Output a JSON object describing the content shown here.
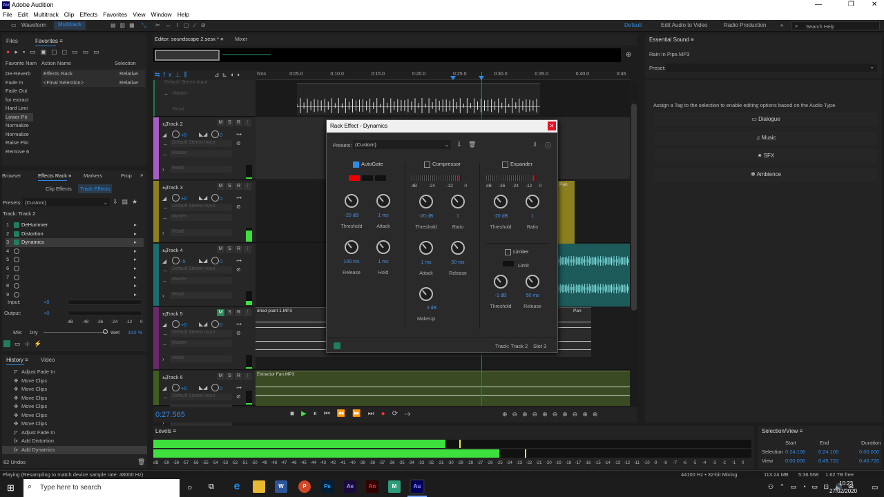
{
  "app": {
    "title": "Adobe Audition"
  },
  "menu": [
    "File",
    "Edit",
    "Multitrack",
    "Clip",
    "Effects",
    "Favorites",
    "View",
    "Window",
    "Help"
  ],
  "toolbar": {
    "waveform": "Waveform",
    "multitrack": "Multitrack",
    "workspaces": [
      "Default",
      "Edit Audio to Video",
      "Radio Production"
    ],
    "search_placeholder": "Search Help"
  },
  "files_panel": {
    "tabs": [
      "Files",
      "Favorites"
    ],
    "columns": [
      "Favorite Nam",
      "Action Name",
      "Selection"
    ],
    "favorites": [
      "De-Reverb",
      "Fade In",
      "Fade Out",
      "for extract",
      "Hard Limi",
      "Lower Pit",
      "Normalize",
      "Normalize",
      "Raise Pitc",
      "Remove 6"
    ],
    "actions": [
      {
        "name": "Effects Rack",
        "sel": "Relative"
      },
      {
        "name": "<Final Selection>",
        "sel": "Relative"
      }
    ]
  },
  "effects_rack": {
    "tabs": [
      "Browser",
      "Effects Rack",
      "Markers",
      "Prop"
    ],
    "subtabs": [
      "Clip Effects",
      "Track Effects"
    ],
    "presets_label": "Presets:",
    "preset": "(Custom)",
    "track": "Track: Track 2",
    "slots": [
      "1",
      "2",
      "3",
      "4",
      "5",
      "6",
      "7",
      "8",
      "9"
    ],
    "effects": [
      "DeHummer",
      "Distortion",
      "Dynamics"
    ],
    "input_label": "Input:",
    "input_val": "+0",
    "output_label": "Output:",
    "output_val": "+0",
    "scale": [
      "dB",
      "-48",
      "-36",
      "-24",
      "-12",
      "0"
    ],
    "mix": "Mix:",
    "dry": "Dry",
    "wet": "Wet",
    "wet_val": "100 %"
  },
  "history": {
    "tabs": [
      "History",
      "Video"
    ],
    "items": [
      "Adjust Fade In",
      "Move Clips",
      "Move Clips",
      "Move Clips",
      "Move Clips",
      "Move Clips",
      "Move Clips",
      "Adjust Fade In",
      "Add Distortion",
      "Add Dynamics"
    ],
    "undos": "82 Undos"
  },
  "editor": {
    "tab": "Editor: soundscape 2.sesx *",
    "mixer": "Mixer",
    "ruler": [
      "hms",
      "0:05.0",
      "0:10.0",
      "0:15.0",
      "0:20.0",
      "0:25.0",
      "0:30.0",
      "0:35.0",
      "0:40.0",
      "0:45"
    ],
    "time": "0:27.565"
  },
  "tracks": [
    {
      "name": "Track 2",
      "vol": "+0",
      "pan": "0",
      "input": "Default Stereo Input",
      "out": "Master",
      "read": "Read"
    },
    {
      "name": "Track 3",
      "vol": "+0",
      "pan": "0",
      "input": "Default Stereo Input",
      "out": "Master",
      "read": "Read"
    },
    {
      "name": "Track 4",
      "vol": "-5",
      "pan": "0",
      "input": "Default Stereo Input",
      "out": "Master",
      "read": "Read"
    },
    {
      "name": "Track 5",
      "vol": "+0",
      "pan": "0",
      "input": "Default Stereo Input",
      "out": "Master",
      "read": "Read"
    },
    {
      "name": "Track 6",
      "vol": "+0",
      "pan": "0",
      "input": "Default Stereo Input",
      "out": "",
      "read": ""
    }
  ],
  "track_top": {
    "input": "Default Stereo Input",
    "out": "Master",
    "read": "Read"
  },
  "clips": {
    "c5": "dried plant 1.MP3",
    "c6": "Extractor Fan.MP3",
    "pan": "Pan"
  },
  "dialog": {
    "title": "Rack Effect - Dynamics",
    "presets_label": "Presets:",
    "preset": "(Custom)",
    "autogate": "AutoGate",
    "compressor": "Compressor",
    "expander": "Expander",
    "limiter": "Limiter",
    "limit": "Limit",
    "meter_scale_c": [
      "dB",
      "-24",
      "-12",
      "0"
    ],
    "meter_scale_e": [
      "dB",
      "-36",
      "-24",
      "-12",
      "0"
    ],
    "gate": {
      "threshold": "-20 dB",
      "attack": "1 ms",
      "release": "100 ms",
      "hold": "1 ms"
    },
    "comp": {
      "threshold": "-20 dB",
      "ratio": "1",
      "attack": "1 ms",
      "release": "50 ms",
      "makeup": "0 dB"
    },
    "exp": {
      "threshold": "-20 dB",
      "ratio": "1"
    },
    "lim": {
      "threshold": "-1 dB",
      "release": "50 ms"
    },
    "labels": {
      "threshold": "Threshold",
      "attack": "Attack",
      "release": "Release",
      "hold": "Hold",
      "ratio": "Ratio",
      "makeup": "MakeUp"
    },
    "footer_track": "Track: Track 2",
    "footer_slot": "Slot 3"
  },
  "essential": {
    "title": "Essential Sound",
    "file": "Rain In Pipe.MP3",
    "preset": "Preset:",
    "hint": "Assign a Tag to the selection to enable editing options based on the Audio Type.",
    "buttons": [
      "Dialogue",
      "Music",
      "SFX",
      "Ambience"
    ]
  },
  "levels": {
    "title": "Levels",
    "scale": [
      "dB",
      "-59",
      "-58",
      "-57",
      "-56",
      "-55",
      "-54",
      "-53",
      "-52",
      "-51",
      "-50",
      "-49",
      "-48",
      "-47",
      "-46",
      "-45",
      "-44",
      "-43",
      "-42",
      "-41",
      "-40",
      "-39",
      "-38",
      "-37",
      "-36",
      "-35",
      "-34",
      "-33",
      "-32",
      "-31",
      "-30",
      "-29",
      "-28",
      "-27",
      "-26",
      "-25",
      "-24",
      "-23",
      "-22",
      "-21",
      "-20",
      "-19",
      "-18",
      "-17",
      "-16",
      "-15",
      "-14",
      "-13",
      "-12",
      "-11",
      "-10",
      "-9",
      "-8",
      "-7",
      "-6",
      "-5",
      "-4",
      "-3",
      "-2",
      "-1",
      "0"
    ]
  },
  "selection": {
    "title": "Selection/View",
    "cols": [
      "Start",
      "End",
      "Duration"
    ],
    "sel_label": "Selection",
    "sel": [
      "0:24.106",
      "0:24.106",
      "0:00.000"
    ],
    "view_label": "View",
    "view": [
      "0:00.000",
      "0:45.720",
      "0:45.720"
    ]
  },
  "status": {
    "left": "Playing (Resampling to match device sample rate: 48000 Hz)",
    "rate": "44100 Hz • 32-bit Mixing",
    "mem": "113.24 MB",
    "dur": "5:36.568",
    "free": "1.62 TB free"
  },
  "taskbar": {
    "search": "Type here to search",
    "time": "10:23",
    "date": "27/02/2020"
  },
  "colors": {
    "accent": "#2d8ceb",
    "green": "#3ee03e",
    "track2": "#a65ec4",
    "track3": "#8b7f1f",
    "track4": "#1d6e6e",
    "track5": "#6a2a6a",
    "track6": "#3f5d1f"
  }
}
